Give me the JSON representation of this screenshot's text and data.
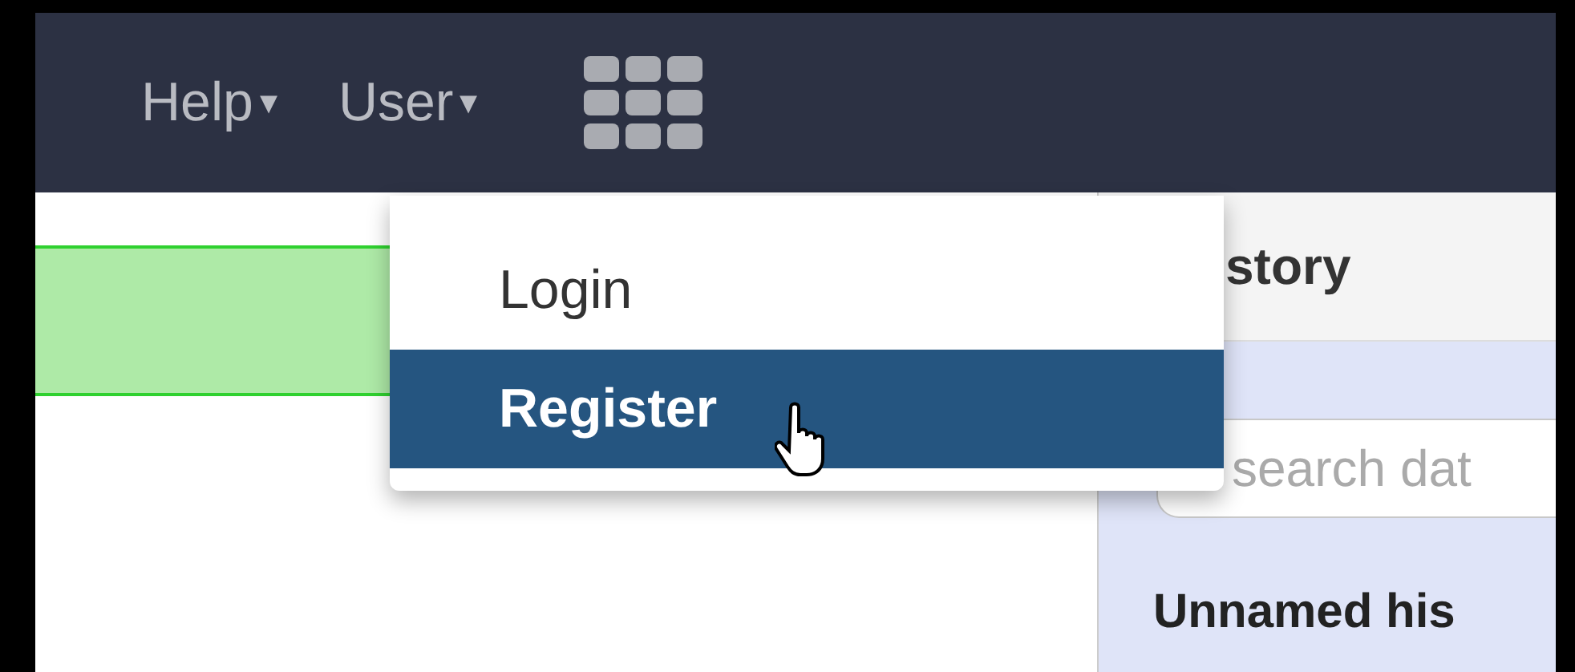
{
  "navbar": {
    "menus": [
      {
        "label": "Help",
        "caret": "▾"
      },
      {
        "label": "User",
        "caret": "▾"
      }
    ]
  },
  "user_menu": {
    "items": [
      {
        "label": "Login",
        "selected": false
      },
      {
        "label": "Register",
        "selected": true
      }
    ]
  },
  "history": {
    "header": "story",
    "search": {
      "placeholder": "search dat"
    },
    "name": "Unnamed his"
  }
}
